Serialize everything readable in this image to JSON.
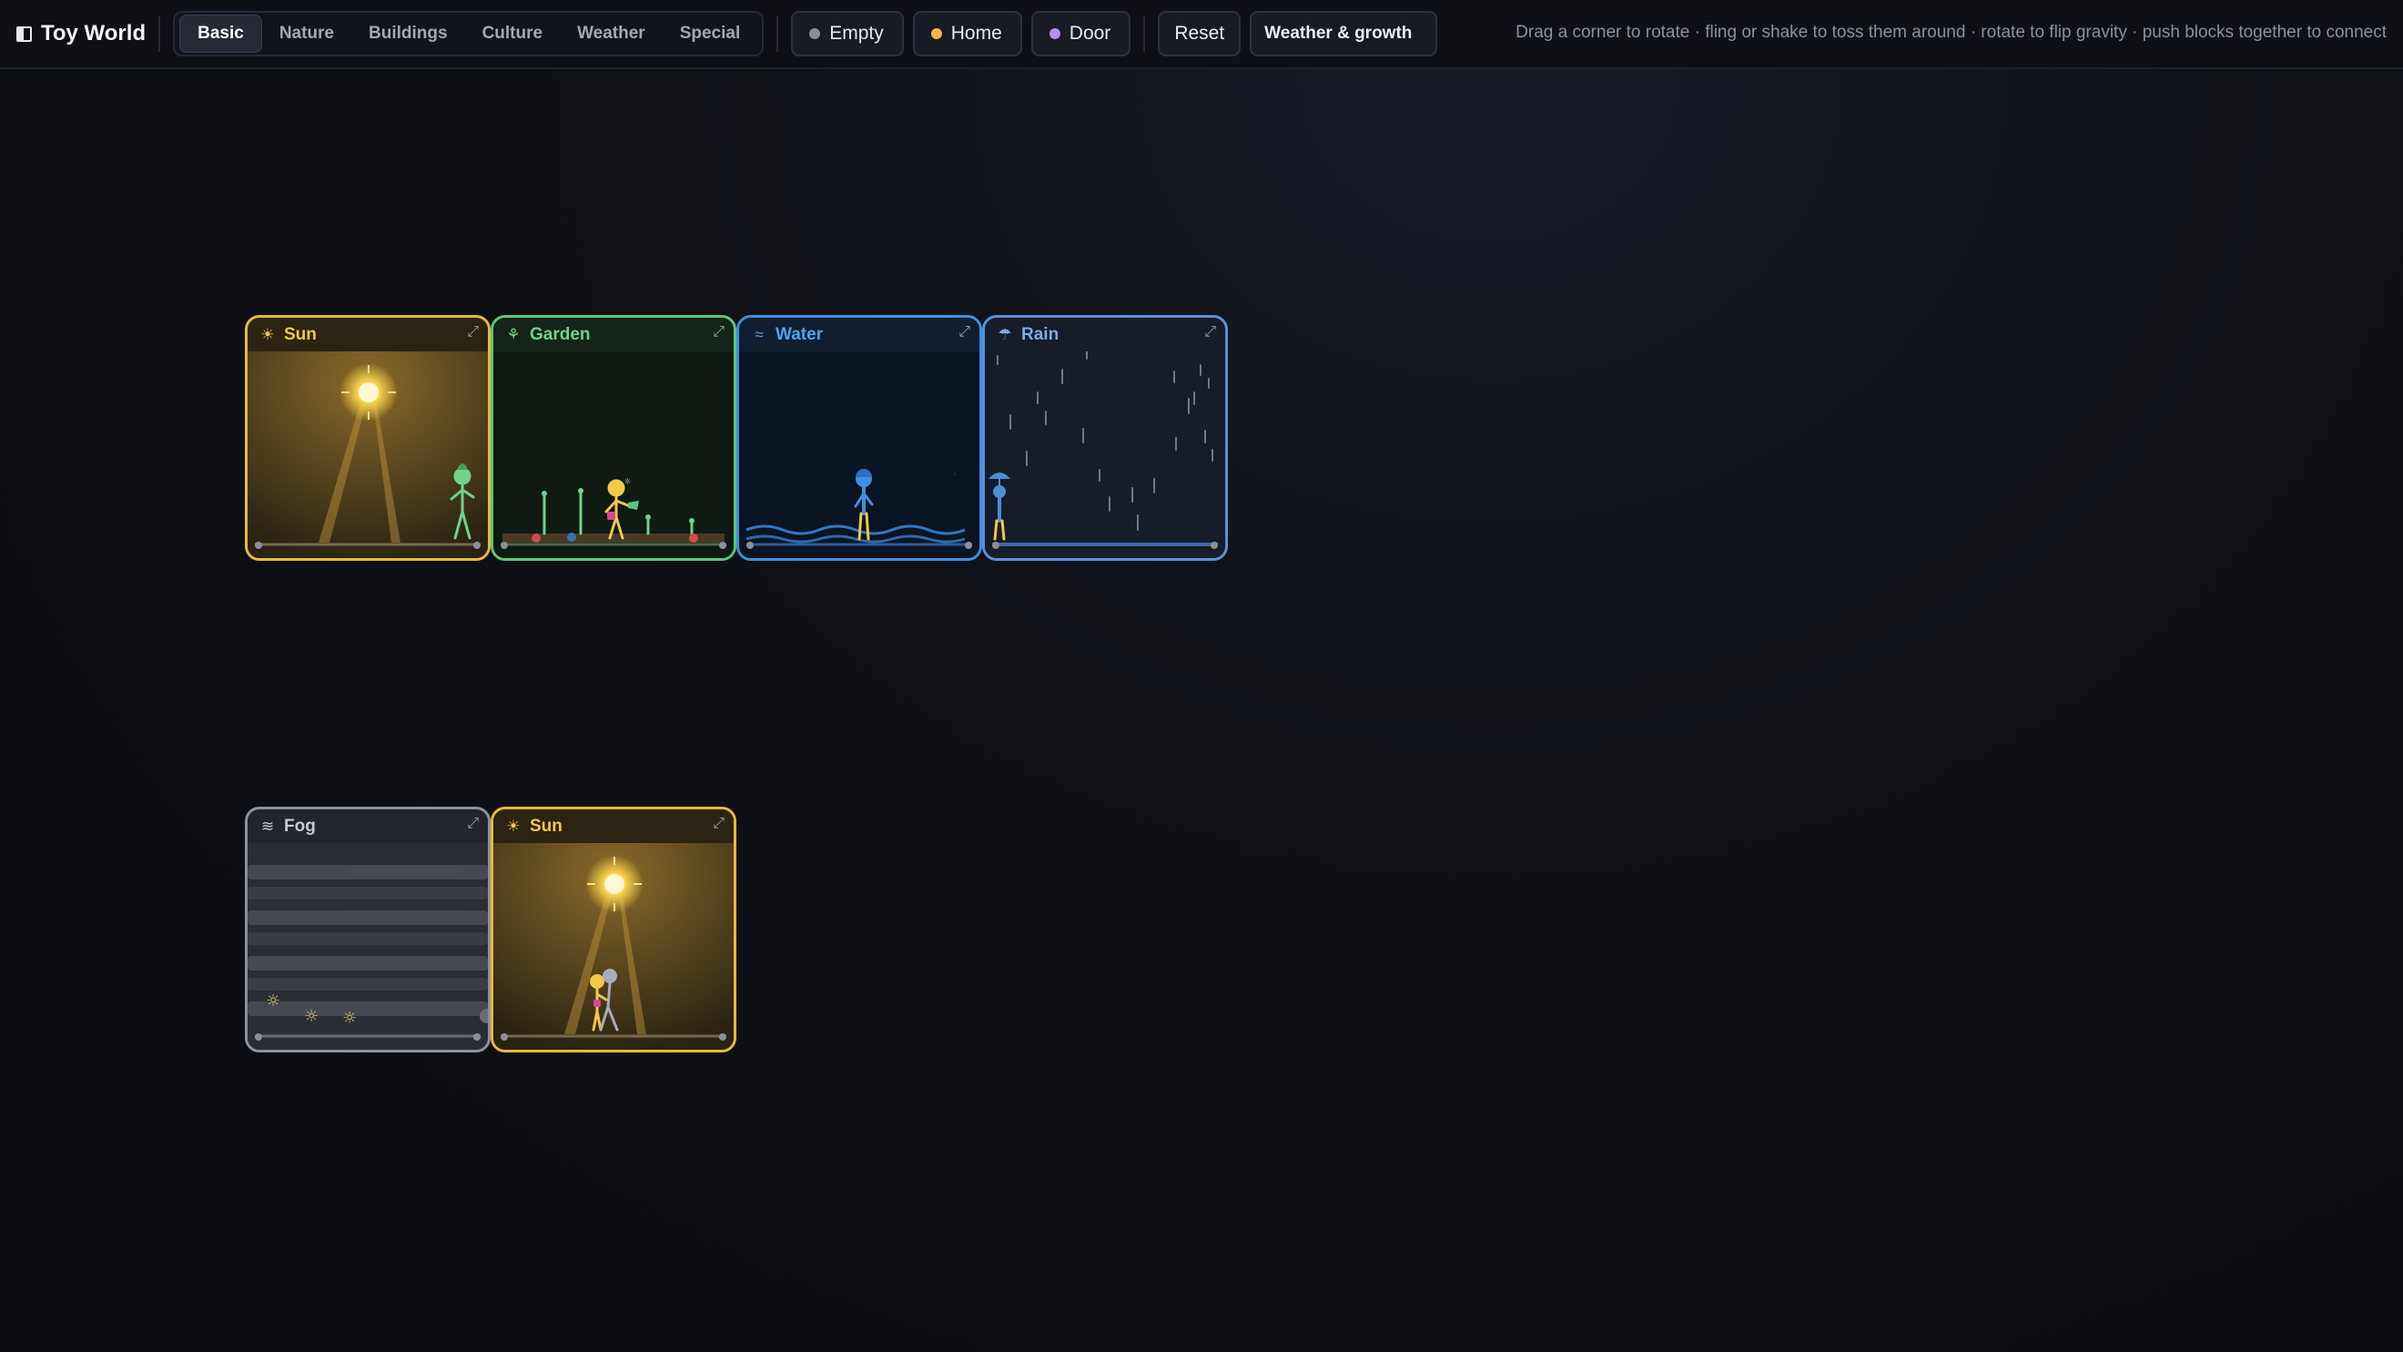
{
  "app": {
    "title": "Toy World"
  },
  "tabs": [
    {
      "label": "Basic",
      "active": true
    },
    {
      "label": "Nature",
      "active": false
    },
    {
      "label": "Buildings",
      "active": false
    },
    {
      "label": "Culture",
      "active": false
    },
    {
      "label": "Weather",
      "active": false
    },
    {
      "label": "Special",
      "active": false
    }
  ],
  "toggles": [
    {
      "label": "Empty",
      "dot_color": "#8a8f9c"
    },
    {
      "label": "Home",
      "dot_color": "#f0b64a"
    },
    {
      "label": "Door",
      "dot_color": "#b88df0"
    }
  ],
  "actions": {
    "reset": "Reset",
    "weather": "Weather & growth"
  },
  "hint": "Drag a corner to rotate · fling or shake to toss them around · rotate to flip gravity · push blocks together to connect",
  "cards": [
    {
      "id": "sun-1",
      "title": "Sun",
      "icon": "sun-icon",
      "glyph": "☀",
      "accent": "#e9b93c",
      "head_bg": "#2b2412"
    },
    {
      "id": "garden",
      "title": "Garden",
      "icon": "sprout-icon",
      "glyph": "🌱",
      "accent": "#5cc77a",
      "head_bg": "#15241a"
    },
    {
      "id": "water",
      "title": "Water",
      "icon": "waves-icon",
      "glyph": "≈",
      "accent": "#3f8fe0",
      "head_bg": "#111e30"
    },
    {
      "id": "rain",
      "title": "Rain",
      "icon": "rain-cloud-icon",
      "glyph": "☂",
      "accent": "#5b93d8",
      "head_bg": "#161c29"
    },
    {
      "id": "fog",
      "title": "Fog",
      "icon": "fog-icon",
      "glyph": "≋",
      "accent": "#8d929c",
      "head_bg": "#22252c"
    },
    {
      "id": "sun-2",
      "title": "Sun",
      "icon": "sun-icon",
      "glyph": "☀",
      "accent": "#e9b93c",
      "head_bg": "#2b2412"
    }
  ],
  "colors": {
    "background": "#0e1016",
    "sun": "#e9b93c",
    "garden": "#5cc77a",
    "water": "#3f8fe0",
    "rain": "#5b93d8",
    "fog": "#8d929c"
  }
}
